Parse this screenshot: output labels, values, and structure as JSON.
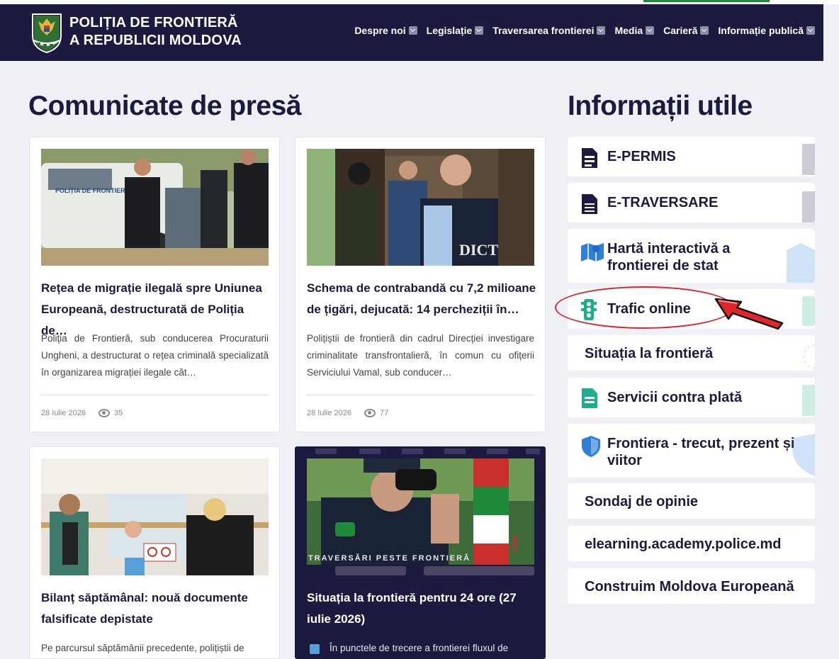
{
  "header": {
    "brand_line1": "POLIȚIA DE FRONTIERĂ",
    "brand_line2": "A REPUBLICII MOLDOVA",
    "nav": [
      {
        "label": "Despre noi"
      },
      {
        "label": "Legislație"
      },
      {
        "label": "Traversarea frontierei"
      },
      {
        "label": "Media"
      },
      {
        "label": "Carieră"
      },
      {
        "label": "Informație publică"
      }
    ]
  },
  "press": {
    "title": "Comunicate de presă",
    "cards": [
      {
        "title": "Rețea de migrație ilegală spre Uniunea Europeană, destructurată de Poliția de…",
        "excerpt": "Poliția de Frontieră, sub conducerea Procuraturii Ungheni, a destructurat o rețea criminală specializată în organizarea migrației ilegale căt…",
        "date": "28 Iulie 2026",
        "views": "35",
        "image_text": "POLIȚIA DE FRONTIERĂ"
      },
      {
        "title": "Schema de contrabandă cu 7,2 milioane de țigări, dejucată: 14 percheziții în…",
        "excerpt": "Polițiștii de frontieră din cadrul Direcției investigare criminalitate transfrontalieră, în comun cu ofițerii Serviciului Vamal, sub conducer…",
        "date": "28 Iulie 2026",
        "views": "77",
        "image_text": "DICT"
      },
      {
        "title": "Bilanț săptămânal: nouă documente falsificate depistate",
        "excerpt": "Pe parcursul săptămânii precedente, polițiștii de"
      },
      {
        "title": "Situația la frontieră pentru 24 ore (27 iulie 2026)",
        "excerpt": "În punctele de trecere a frontierei fluxul de",
        "image_text": "TRAVERSĂRI PESTE FRONTIERĂ",
        "image_number": "0597"
      }
    ]
  },
  "info": {
    "title": "Informații utile",
    "items": [
      {
        "label": "E-PERMIS",
        "icon": "document-icon"
      },
      {
        "label": "E-TRAVERSARE",
        "icon": "document-icon"
      },
      {
        "label": "Hartă interactivă a frontierei de stat",
        "icon": "map-icon"
      },
      {
        "label": "Trafic online",
        "icon": "traffic-light-icon"
      },
      {
        "label": "Situația la frontieră"
      },
      {
        "label": "Servicii contra plată",
        "icon": "document-icon"
      },
      {
        "label": "Frontiera - trecut, prezent și viitor",
        "icon": "shield-icon"
      },
      {
        "label": "Sondaj de opinie"
      },
      {
        "label": "elearning.academy.police.md"
      },
      {
        "label": "Construim Moldova Europeană"
      }
    ]
  },
  "colors": {
    "navy": "#1c1a3e",
    "teal": "#1fae8a",
    "blue": "#2f7fd6",
    "annotation_red": "#d9262c"
  }
}
